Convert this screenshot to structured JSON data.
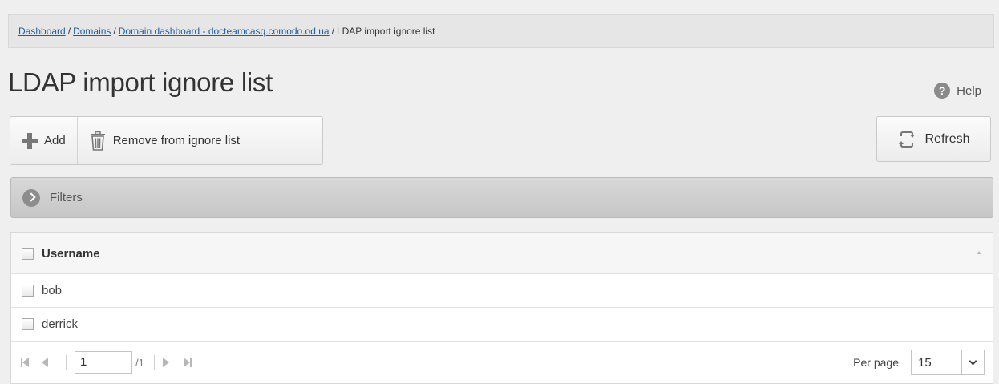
{
  "breadcrumb": {
    "items": [
      {
        "label": "Dashboard",
        "link": true
      },
      {
        "label": "Domains",
        "link": true
      },
      {
        "label": "Domain dashboard - docteamcasq.comodo.od.ua",
        "link": true
      },
      {
        "label": "LDAP import ignore list",
        "link": false
      }
    ],
    "separator": "/"
  },
  "page": {
    "title": "LDAP import ignore list",
    "help_label": "Help",
    "help_icon_glyph": "?"
  },
  "toolbar": {
    "add_label": "Add",
    "remove_label": "Remove from ignore list",
    "refresh_label": "Refresh"
  },
  "filters": {
    "label": "Filters"
  },
  "table": {
    "columns": [
      "Username"
    ],
    "rows": [
      {
        "username": "bob"
      },
      {
        "username": "derrick"
      }
    ]
  },
  "pagination": {
    "current_page": "1",
    "total_pages_text": "/1",
    "per_page_label": "Per page",
    "per_page_value": "15"
  },
  "colors": {
    "link": "#1a5ea8",
    "background": "#efefef"
  }
}
